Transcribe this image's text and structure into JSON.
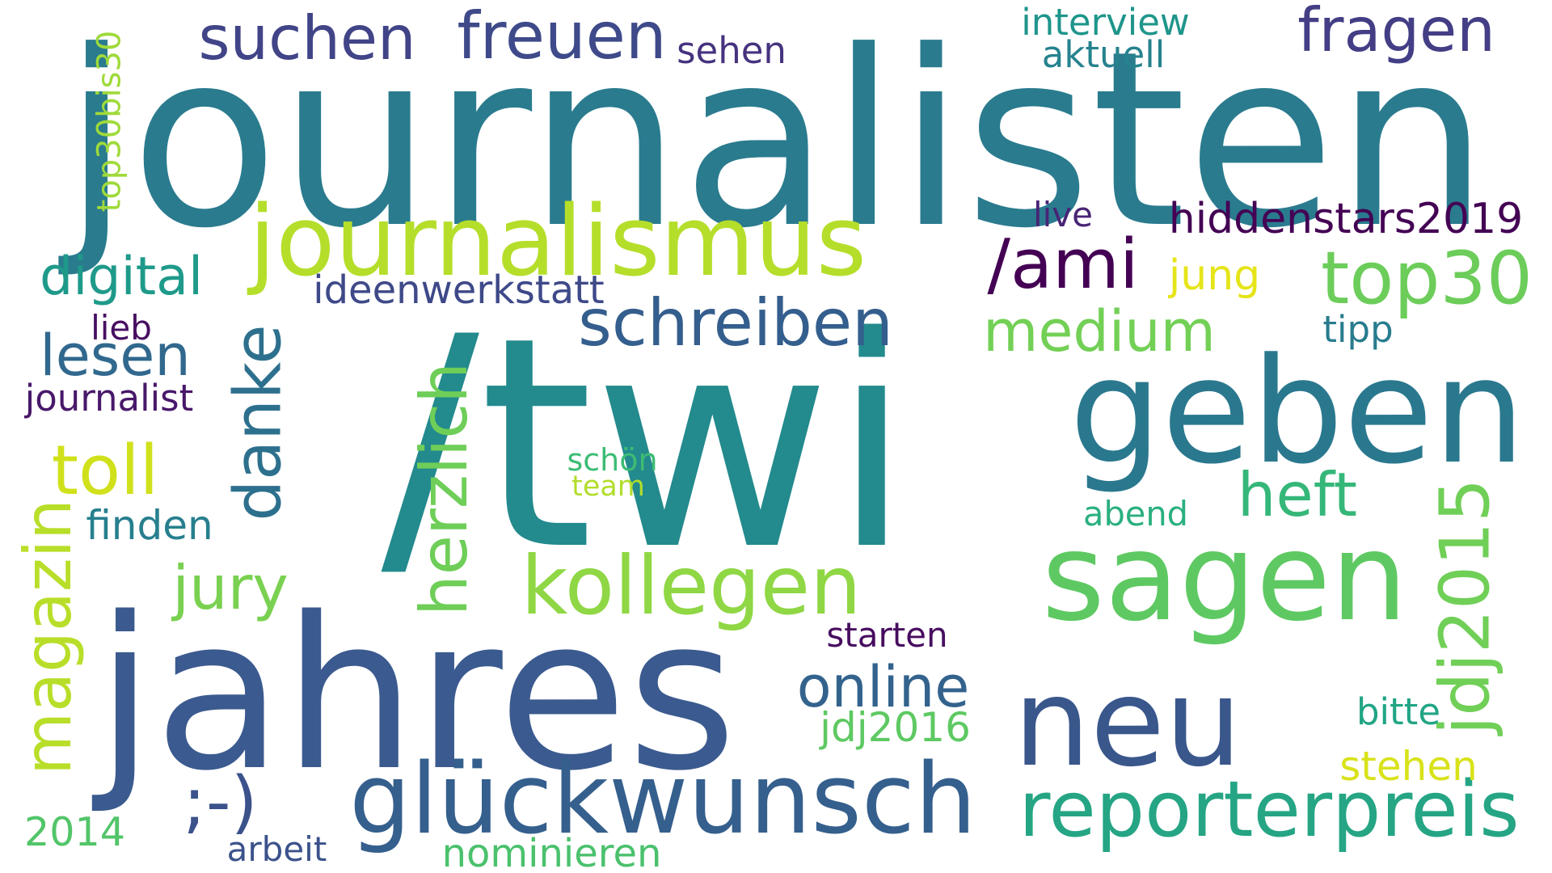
{
  "words": [
    {
      "text": "journalisten",
      "color": "#2a7b8e"
    },
    {
      "text": "/twi",
      "color": "#238a8d"
    },
    {
      "text": "jahres",
      "color": "#3b5a8f"
    },
    {
      "text": "sagen",
      "color": "#5ec962"
    },
    {
      "text": "geben",
      "color": "#2a788e"
    },
    {
      "text": "neu",
      "color": "#3a578c"
    },
    {
      "text": "glückwunsch",
      "color": "#355f8d"
    },
    {
      "text": "journalismus",
      "color": "#b5de2b"
    },
    {
      "text": "reporterpreis",
      "color": "#25a584"
    },
    {
      "text": "kollegen",
      "color": "#8fd744"
    },
    {
      "text": "/ami",
      "color": "#440154"
    },
    {
      "text": "top30",
      "color": "#6ccd5a"
    },
    {
      "text": "suchen",
      "color": "#414487"
    },
    {
      "text": "freuen",
      "color": "#3e4a89"
    },
    {
      "text": "fragen",
      "color": "#433e85"
    },
    {
      "text": "schreiben",
      "color": "#345e8d"
    },
    {
      "text": "medium",
      "color": "#73d056"
    },
    {
      "text": "toll",
      "color": "#d0e11c"
    },
    {
      "text": "lesen",
      "color": "#31688e"
    },
    {
      "text": "danke",
      "color": "#2d708e"
    },
    {
      "text": "herzlich",
      "color": "#6ece58"
    },
    {
      "text": "heft",
      "color": "#35b779"
    },
    {
      "text": "jdj2015",
      "color": "#70cf57"
    },
    {
      "text": "online",
      "color": "#33638d"
    },
    {
      "text": "digital",
      "color": "#1f9a8a"
    },
    {
      "text": "magazin",
      "color": "#b8de29"
    },
    {
      "text": "jury",
      "color": "#7ad151"
    },
    {
      "text": ";-)",
      "color": "#3b528b"
    },
    {
      "text": "top30bis30",
      "color": "#9fda3a"
    },
    {
      "text": "interview",
      "color": "#1f958b"
    },
    {
      "text": "aktuell",
      "color": "#26828e"
    },
    {
      "text": "sehen",
      "color": "#46337e"
    },
    {
      "text": "hiddenstars2019",
      "color": "#440154"
    },
    {
      "text": "live",
      "color": "#482475"
    },
    {
      "text": "ideenwerkstatt",
      "color": "#3e4989"
    },
    {
      "text": "jung",
      "color": "#e5e419"
    },
    {
      "text": "tipp",
      "color": "#287c8e"
    },
    {
      "text": "lieb",
      "color": "#470e61"
    },
    {
      "text": "journalist",
      "color": "#48186a"
    },
    {
      "text": "finden",
      "color": "#277f8e"
    },
    {
      "text": "schön",
      "color": "#3dbc74"
    },
    {
      "text": "team",
      "color": "#b2dd2d"
    },
    {
      "text": "abend",
      "color": "#2ab07f"
    },
    {
      "text": "jdj2016",
      "color": "#5ec962"
    },
    {
      "text": "bitte",
      "color": "#21a585"
    },
    {
      "text": "stehen",
      "color": "#d8e219"
    },
    {
      "text": "starten",
      "color": "#470d60"
    },
    {
      "text": "2014",
      "color": "#52c569"
    },
    {
      "text": "arbeit",
      "color": "#3b528b"
    },
    {
      "text": "nominieren",
      "color": "#4ac16d"
    }
  ]
}
